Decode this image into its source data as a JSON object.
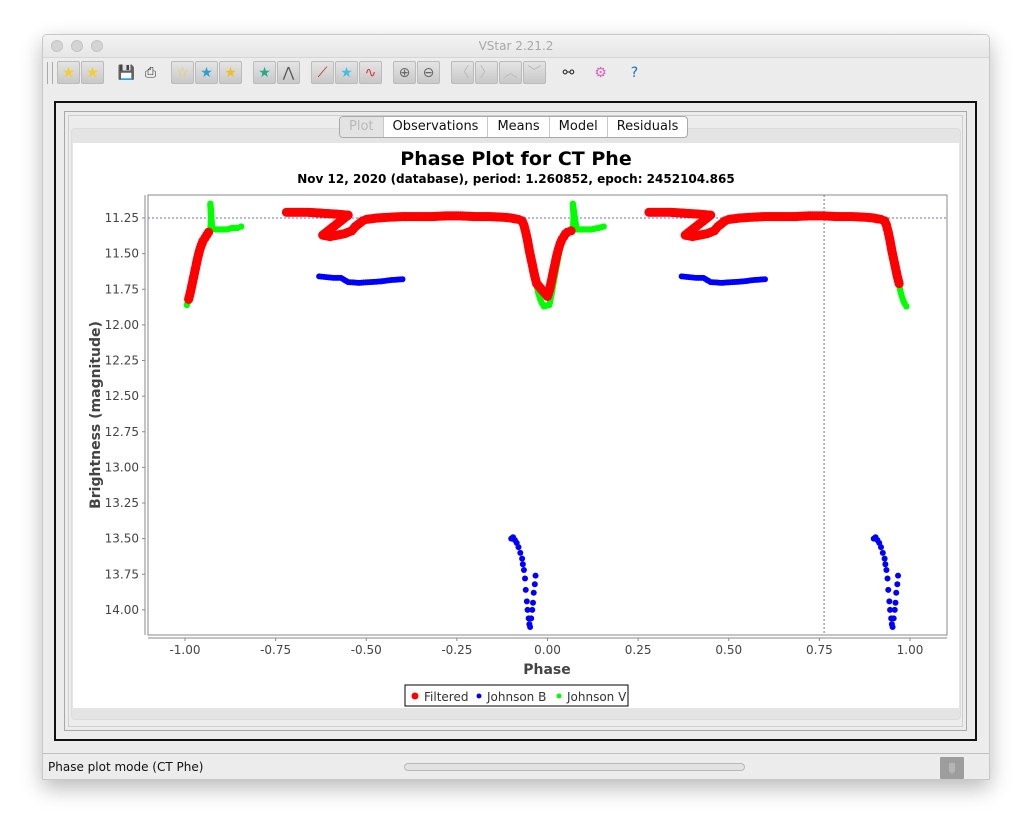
{
  "window": {
    "title": "VStar 2.21.2"
  },
  "toolbar": {
    "buttons": [
      {
        "name": "new-star-from-database-button",
        "icon": "database-star-icon",
        "glyph": "★"
      },
      {
        "name": "new-star-from-file-button",
        "icon": "folder-star-icon",
        "glyph": "★"
      },
      {
        "name": "save-button",
        "icon": "floppy-disk-icon",
        "glyph": "💾"
      },
      {
        "name": "print-button",
        "icon": "printer-icon",
        "glyph": "⎙"
      },
      {
        "name": "info-button",
        "icon": "star-info-icon",
        "glyph": "☆"
      },
      {
        "name": "plot-control-button",
        "icon": "star-monitor-icon",
        "glyph": "★"
      },
      {
        "name": "view-details-button",
        "icon": "star-document-icon",
        "glyph": "★"
      },
      {
        "name": "ranges-button",
        "icon": "star-binary-icon",
        "glyph": "★"
      },
      {
        "name": "raw-data-button",
        "icon": "waveform-icon",
        "glyph": "⋀"
      },
      {
        "name": "phase-plot-button",
        "icon": "chart-check-icon",
        "glyph": "⟋"
      },
      {
        "name": "period-search-button",
        "icon": "rainbow-star-icon",
        "glyph": "★"
      },
      {
        "name": "polynomial-fit-button",
        "icon": "red-green-wave-icon",
        "glyph": "∿"
      },
      {
        "name": "zoom-in-button",
        "icon": "zoom-in-icon",
        "glyph": "⊕"
      },
      {
        "name": "zoom-out-button",
        "icon": "zoom-out-icon",
        "glyph": "⊖"
      },
      {
        "name": "pan-left-button",
        "icon": "chevron-left-icon",
        "glyph": "〈"
      },
      {
        "name": "pan-right-button",
        "icon": "chevron-right-icon",
        "glyph": "〉"
      },
      {
        "name": "pan-up-button",
        "icon": "chevron-up-icon",
        "glyph": "︿"
      },
      {
        "name": "pan-down-button",
        "icon": "chevron-down-icon",
        "glyph": "﹀"
      },
      {
        "name": "filter-button",
        "icon": "binoculars-icon",
        "glyph": "⚯"
      },
      {
        "name": "preferences-button",
        "icon": "gears-icon",
        "glyph": "⚙"
      },
      {
        "name": "help-button",
        "icon": "help-book-icon",
        "glyph": "?"
      }
    ]
  },
  "tabs": [
    {
      "label": "Plot",
      "selected": true
    },
    {
      "label": "Observations",
      "selected": false
    },
    {
      "label": "Means",
      "selected": false
    },
    {
      "label": "Model",
      "selected": false
    },
    {
      "label": "Residuals",
      "selected": false
    }
  ],
  "status": {
    "text": "Phase plot mode (CT Phe)",
    "progress": 0
  },
  "colors": {
    "filtered": "#ff0000",
    "johnson_b": "#0000ff",
    "johnson_v": "#00ff00",
    "crosshair": "#6666ff"
  },
  "chart_data": {
    "type": "scatter",
    "title": "Phase Plot for CT Phe",
    "subtitle": "Nov 12, 2020 (database), period: 1.260852, epoch: 2452104.865",
    "xlabel": "Phase",
    "ylabel": "Brightness (magnitude)",
    "xlim": [
      -1.1,
      1.1
    ],
    "ylim": [
      14.1,
      11.1
    ],
    "y_inverted": true,
    "x_ticks": [
      "-1.00",
      "-0.75",
      "-0.50",
      "-0.25",
      "0.00",
      "0.25",
      "0.50",
      "0.75",
      "1.00"
    ],
    "x_tick_values": [
      -1.0,
      -0.75,
      -0.5,
      -0.25,
      0.0,
      0.25,
      0.5,
      0.75,
      1.0
    ],
    "y_ticks": [
      "11.25",
      "11.50",
      "11.75",
      "12.00",
      "12.25",
      "12.50",
      "12.75",
      "13.00",
      "13.25",
      "13.50",
      "13.75",
      "14.00"
    ],
    "y_tick_values": [
      11.25,
      11.5,
      11.75,
      12.0,
      12.25,
      12.5,
      12.75,
      13.0,
      13.25,
      13.5,
      13.75,
      14.0
    ],
    "grid": false,
    "crosshair": {
      "x": 0.763,
      "y": 11.25
    },
    "legend": {
      "position": "bottom",
      "entries": [
        "Filtered",
        "Johnson B",
        "Johnson V"
      ]
    },
    "series": [
      {
        "name": "Johnson V",
        "color": "#00ff00",
        "points": [
          [
            -0.995,
            11.86
          ],
          [
            -0.99,
            11.83
          ],
          [
            -0.985,
            11.78
          ],
          [
            -0.98,
            11.72
          ],
          [
            -0.975,
            11.66
          ],
          [
            -0.97,
            11.6
          ],
          [
            -0.965,
            11.54
          ],
          [
            -0.96,
            11.49
          ],
          [
            -0.955,
            11.45
          ],
          [
            -0.95,
            11.41
          ],
          [
            -0.945,
            11.38
          ],
          [
            -0.94,
            11.36
          ],
          [
            -0.935,
            11.34
          ],
          [
            -0.93,
            11.33
          ],
          [
            -0.928,
            11.25
          ],
          [
            -0.93,
            11.15
          ],
          [
            -0.925,
            11.33
          ],
          [
            -0.915,
            11.33
          ],
          [
            -0.9,
            11.33
          ],
          [
            -0.885,
            11.33
          ],
          [
            -0.87,
            11.32
          ],
          [
            -0.855,
            11.32
          ],
          [
            -0.845,
            11.31
          ],
          [
            -0.06,
            11.32
          ],
          [
            -0.055,
            11.38
          ],
          [
            -0.05,
            11.45
          ],
          [
            -0.045,
            11.52
          ],
          [
            -0.04,
            11.59
          ],
          [
            -0.035,
            11.66
          ],
          [
            -0.03,
            11.72
          ],
          [
            -0.025,
            11.78
          ],
          [
            -0.02,
            11.82
          ],
          [
            -0.015,
            11.85
          ],
          [
            -0.01,
            11.87
          ],
          [
            0.005,
            11.86
          ],
          [
            0.01,
            11.8
          ],
          [
            0.015,
            11.73
          ],
          [
            0.02,
            11.66
          ],
          [
            0.025,
            11.59
          ],
          [
            0.03,
            11.52
          ],
          [
            0.035,
            11.46
          ],
          [
            0.04,
            11.41
          ],
          [
            0.045,
            11.37
          ],
          [
            0.05,
            11.35
          ],
          [
            0.06,
            11.34
          ],
          [
            0.07,
            11.33
          ],
          [
            0.072,
            11.25
          ],
          [
            0.07,
            11.15
          ],
          [
            0.08,
            11.33
          ],
          [
            0.1,
            11.33
          ],
          [
            0.12,
            11.33
          ],
          [
            0.14,
            11.32
          ],
          [
            0.155,
            11.31
          ],
          [
            0.94,
            11.32
          ],
          [
            0.945,
            11.38
          ],
          [
            0.95,
            11.45
          ],
          [
            0.955,
            11.52
          ],
          [
            0.96,
            11.59
          ],
          [
            0.965,
            11.66
          ],
          [
            0.97,
            11.72
          ],
          [
            0.975,
            11.78
          ],
          [
            0.98,
            11.82
          ],
          [
            0.985,
            11.85
          ],
          [
            0.99,
            11.87
          ]
        ]
      },
      {
        "name": "Johnson B",
        "color": "#0000ff",
        "points": [
          [
            -0.63,
            11.66
          ],
          [
            -0.61,
            11.665
          ],
          [
            -0.59,
            11.67
          ],
          [
            -0.57,
            11.67
          ],
          [
            -0.55,
            11.7
          ],
          [
            -0.52,
            11.705
          ],
          [
            -0.49,
            11.7
          ],
          [
            -0.46,
            11.695
          ],
          [
            -0.43,
            11.685
          ],
          [
            -0.4,
            11.68
          ],
          [
            -0.1,
            13.5
          ],
          [
            -0.095,
            13.49
          ],
          [
            -0.09,
            13.51
          ],
          [
            -0.085,
            13.53
          ],
          [
            -0.08,
            13.56
          ],
          [
            -0.075,
            13.6
          ],
          [
            -0.07,
            13.64
          ],
          [
            -0.068,
            13.68
          ],
          [
            -0.065,
            13.72
          ],
          [
            -0.062,
            13.78
          ],
          [
            -0.06,
            13.86
          ],
          [
            -0.057,
            13.94
          ],
          [
            -0.055,
            14.0
          ],
          [
            -0.052,
            14.06
          ],
          [
            -0.05,
            14.1
          ],
          [
            -0.048,
            14.12
          ],
          [
            -0.045,
            14.06
          ],
          [
            -0.042,
            14.0
          ],
          [
            -0.04,
            13.95
          ],
          [
            -0.038,
            13.88
          ],
          [
            -0.035,
            13.82
          ],
          [
            -0.033,
            13.76
          ],
          [
            0.37,
            11.66
          ],
          [
            0.39,
            11.665
          ],
          [
            0.41,
            11.67
          ],
          [
            0.43,
            11.67
          ],
          [
            0.45,
            11.7
          ],
          [
            0.48,
            11.705
          ],
          [
            0.51,
            11.7
          ],
          [
            0.54,
            11.695
          ],
          [
            0.57,
            11.685
          ],
          [
            0.6,
            11.68
          ],
          [
            0.9,
            13.5
          ],
          [
            0.905,
            13.49
          ],
          [
            0.91,
            13.51
          ],
          [
            0.915,
            13.53
          ],
          [
            0.92,
            13.56
          ],
          [
            0.925,
            13.6
          ],
          [
            0.93,
            13.64
          ],
          [
            0.932,
            13.68
          ],
          [
            0.935,
            13.72
          ],
          [
            0.938,
            13.78
          ],
          [
            0.94,
            13.86
          ],
          [
            0.943,
            13.94
          ],
          [
            0.945,
            14.0
          ],
          [
            0.948,
            14.06
          ],
          [
            0.95,
            14.1
          ],
          [
            0.952,
            14.12
          ],
          [
            0.955,
            14.06
          ],
          [
            0.958,
            14.0
          ],
          [
            0.96,
            13.95
          ],
          [
            0.962,
            13.88
          ],
          [
            0.965,
            13.82
          ],
          [
            0.967,
            13.76
          ]
        ]
      },
      {
        "name": "Filtered",
        "color": "#ff0000",
        "points": [
          [
            -0.99,
            11.82
          ],
          [
            -0.985,
            11.77
          ],
          [
            -0.98,
            11.71
          ],
          [
            -0.975,
            11.65
          ],
          [
            -0.97,
            11.59
          ],
          [
            -0.965,
            11.53
          ],
          [
            -0.96,
            11.48
          ],
          [
            -0.955,
            11.44
          ],
          [
            -0.95,
            11.41
          ],
          [
            -0.945,
            11.39
          ],
          [
            -0.94,
            11.37
          ],
          [
            -0.935,
            11.35
          ],
          [
            -0.72,
            11.21
          ],
          [
            -0.69,
            11.21
          ],
          [
            -0.66,
            11.21
          ],
          [
            -0.63,
            11.215
          ],
          [
            -0.6,
            11.22
          ],
          [
            -0.57,
            11.225
          ],
          [
            -0.55,
            11.23
          ],
          [
            -0.62,
            11.37
          ],
          [
            -0.6,
            11.38
          ],
          [
            -0.58,
            11.37
          ],
          [
            -0.56,
            11.36
          ],
          [
            -0.54,
            11.34
          ],
          [
            -0.53,
            11.31
          ],
          [
            -0.52,
            11.29
          ],
          [
            -0.51,
            11.27
          ],
          [
            -0.5,
            11.26
          ],
          [
            -0.47,
            11.25
          ],
          [
            -0.44,
            11.245
          ],
          [
            -0.4,
            11.24
          ],
          [
            -0.36,
            11.24
          ],
          [
            -0.32,
            11.24
          ],
          [
            -0.28,
            11.235
          ],
          [
            -0.24,
            11.235
          ],
          [
            -0.2,
            11.24
          ],
          [
            -0.16,
            11.24
          ],
          [
            -0.12,
            11.245
          ],
          [
            -0.1,
            11.25
          ],
          [
            -0.08,
            11.26
          ],
          [
            -0.07,
            11.27
          ],
          [
            -0.065,
            11.3
          ],
          [
            -0.06,
            11.35
          ],
          [
            -0.055,
            11.41
          ],
          [
            -0.05,
            11.48
          ],
          [
            -0.045,
            11.54
          ],
          [
            -0.04,
            11.6
          ],
          [
            -0.035,
            11.66
          ],
          [
            -0.03,
            11.71
          ],
          [
            0.0,
            11.8
          ],
          [
            0.005,
            11.76
          ],
          [
            0.01,
            11.7
          ],
          [
            0.015,
            11.64
          ],
          [
            0.02,
            11.58
          ],
          [
            0.025,
            11.52
          ],
          [
            0.03,
            11.47
          ],
          [
            0.035,
            11.43
          ],
          [
            0.04,
            11.4
          ],
          [
            0.045,
            11.38
          ],
          [
            0.05,
            11.36
          ],
          [
            0.055,
            11.35
          ],
          [
            0.065,
            11.34
          ],
          [
            0.28,
            11.21
          ],
          [
            0.31,
            11.21
          ],
          [
            0.34,
            11.21
          ],
          [
            0.37,
            11.215
          ],
          [
            0.4,
            11.22
          ],
          [
            0.43,
            11.225
          ],
          [
            0.45,
            11.23
          ],
          [
            0.38,
            11.37
          ],
          [
            0.4,
            11.38
          ],
          [
            0.42,
            11.37
          ],
          [
            0.44,
            11.36
          ],
          [
            0.46,
            11.34
          ],
          [
            0.47,
            11.31
          ],
          [
            0.48,
            11.29
          ],
          [
            0.49,
            11.27
          ],
          [
            0.5,
            11.26
          ],
          [
            0.53,
            11.25
          ],
          [
            0.56,
            11.245
          ],
          [
            0.6,
            11.24
          ],
          [
            0.64,
            11.24
          ],
          [
            0.68,
            11.24
          ],
          [
            0.72,
            11.235
          ],
          [
            0.76,
            11.235
          ],
          [
            0.8,
            11.24
          ],
          [
            0.84,
            11.24
          ],
          [
            0.88,
            11.245
          ],
          [
            0.9,
            11.25
          ],
          [
            0.92,
            11.26
          ],
          [
            0.93,
            11.27
          ],
          [
            0.935,
            11.3
          ],
          [
            0.94,
            11.35
          ],
          [
            0.945,
            11.41
          ],
          [
            0.95,
            11.48
          ],
          [
            0.955,
            11.54
          ],
          [
            0.96,
            11.6
          ],
          [
            0.965,
            11.66
          ],
          [
            0.97,
            11.71
          ]
        ]
      }
    ]
  }
}
